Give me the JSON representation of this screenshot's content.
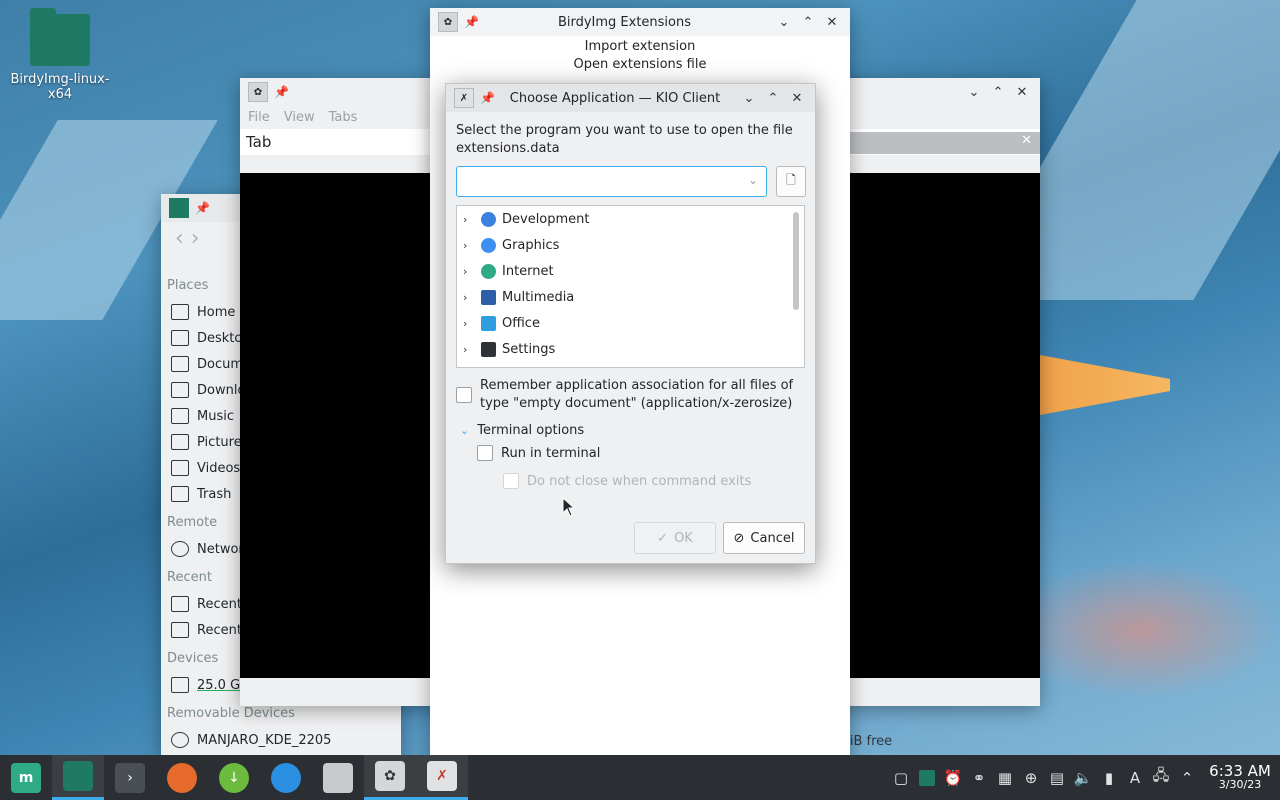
{
  "desktop": {
    "icon_label": "BirdyImg-linux-x64"
  },
  "dolphin": {
    "places_header": "Places",
    "places": [
      "Home",
      "Desktop",
      "Documents",
      "Downloads",
      "Music",
      "Pictures",
      "Videos",
      "Trash"
    ],
    "remote_header": "Remote",
    "remote": [
      "Network"
    ],
    "recent_header": "Recent",
    "recent": [
      "Recent Files",
      "Recent Locations"
    ],
    "devices_header": "Devices",
    "devices": [
      "25.0 GiB Hard Drive"
    ],
    "removable_header": "Removable Devices",
    "removable": [
      "MANJARO_KDE_2205"
    ]
  },
  "tab_window": {
    "menu": [
      "File",
      "View",
      "Tabs"
    ],
    "tab_label": "Tab",
    "status_free": "4.2 GiB free"
  },
  "birdy": {
    "title": "BirdyImg Extensions",
    "line1": "Import extension",
    "line2": "Open extensions file"
  },
  "chooser": {
    "title": "Choose Application — KIO Client",
    "prompt_line1": "Select the program you want to use to open the file",
    "prompt_line2": "extensions.data",
    "combo_value": "",
    "categories": [
      {
        "label": "Development",
        "color": "#3b82e0"
      },
      {
        "label": "Graphics",
        "color": "#3d8ff0"
      },
      {
        "label": "Internet",
        "color": "#2eaa84"
      },
      {
        "label": "Multimedia",
        "color": "#2c5fa8"
      },
      {
        "label": "Office",
        "color": "#2f9ee0"
      },
      {
        "label": "Settings",
        "color": "#2f3337"
      }
    ],
    "remember_label": "Remember application association for all files of type \"empty document\" (application/x-zerosize)",
    "terminal_header": "Terminal options",
    "run_in_terminal": "Run in terminal",
    "no_close": "Do not close when command exits",
    "ok": "OK",
    "cancel": "Cancel"
  },
  "taskbar": {
    "time": "6:33 AM",
    "date": "3/30/23"
  },
  "colors": {
    "accent": "#3daee9",
    "panel": "#2b2f33"
  }
}
